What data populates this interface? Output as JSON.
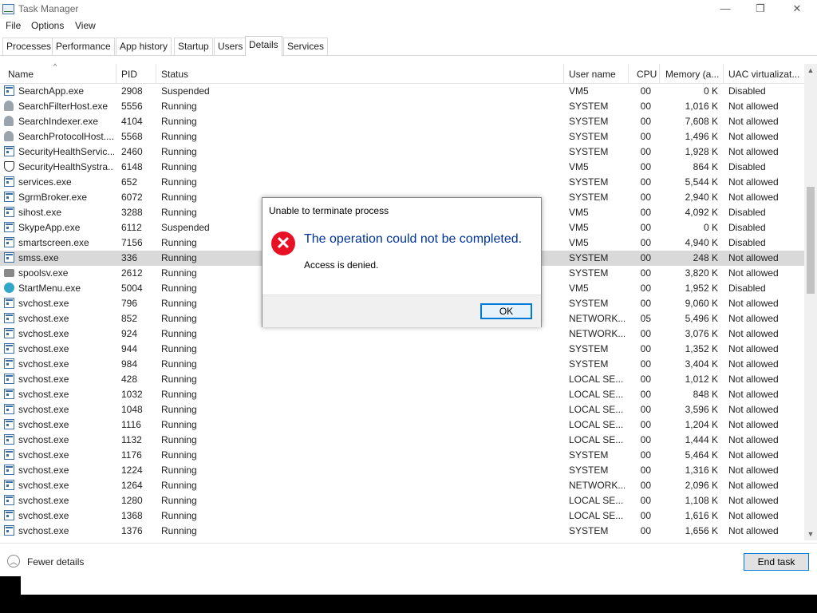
{
  "window": {
    "title": "Task Manager",
    "controls": {
      "minimize": "—",
      "restore": "❐",
      "close": "✕"
    }
  },
  "menu": [
    "File",
    "Options",
    "View"
  ],
  "tabs": [
    {
      "label": "Processes",
      "active": false
    },
    {
      "label": "Performance",
      "active": false
    },
    {
      "label": "App history",
      "active": false
    },
    {
      "label": "Startup",
      "active": false
    },
    {
      "label": "Users",
      "active": false
    },
    {
      "label": "Details",
      "active": true
    },
    {
      "label": "Services",
      "active": false
    }
  ],
  "columns": [
    "Name",
    "PID",
    "Status",
    "User name",
    "CPU",
    "Memory (a...",
    "UAC virtualizat..."
  ],
  "sort_indicator": "^",
  "rows": [
    {
      "icon": "window",
      "name": "SearchApp.exe",
      "pid": "2908",
      "status": "Suspended",
      "user": "VM5",
      "cpu": "00",
      "memory": "0 K",
      "uac": "Disabled"
    },
    {
      "icon": "person",
      "name": "SearchFilterHost.exe",
      "pid": "5556",
      "status": "Running",
      "user": "SYSTEM",
      "cpu": "00",
      "memory": "1,016 K",
      "uac": "Not allowed"
    },
    {
      "icon": "person",
      "name": "SearchIndexer.exe",
      "pid": "4104",
      "status": "Running",
      "user": "SYSTEM",
      "cpu": "00",
      "memory": "7,608 K",
      "uac": "Not allowed"
    },
    {
      "icon": "person",
      "name": "SearchProtocolHost....",
      "pid": "5568",
      "status": "Running",
      "user": "SYSTEM",
      "cpu": "00",
      "memory": "1,496 K",
      "uac": "Not allowed"
    },
    {
      "icon": "window",
      "name": "SecurityHealthServic...",
      "pid": "2460",
      "status": "Running",
      "user": "SYSTEM",
      "cpu": "00",
      "memory": "1,928 K",
      "uac": "Not allowed"
    },
    {
      "icon": "shield",
      "name": "SecurityHealthSystra...",
      "pid": "6148",
      "status": "Running",
      "user": "VM5",
      "cpu": "00",
      "memory": "864 K",
      "uac": "Disabled"
    },
    {
      "icon": "window",
      "name": "services.exe",
      "pid": "652",
      "status": "Running",
      "user": "SYSTEM",
      "cpu": "00",
      "memory": "5,544 K",
      "uac": "Not allowed"
    },
    {
      "icon": "window",
      "name": "SgrmBroker.exe",
      "pid": "6072",
      "status": "Running",
      "user": "SYSTEM",
      "cpu": "00",
      "memory": "2,940 K",
      "uac": "Not allowed"
    },
    {
      "icon": "window",
      "name": "sihost.exe",
      "pid": "3288",
      "status": "Running",
      "user": "VM5",
      "cpu": "00",
      "memory": "4,092 K",
      "uac": "Disabled"
    },
    {
      "icon": "window",
      "name": "SkypeApp.exe",
      "pid": "6112",
      "status": "Suspended",
      "user": "VM5",
      "cpu": "00",
      "memory": "0 K",
      "uac": "Disabled"
    },
    {
      "icon": "window",
      "name": "smartscreen.exe",
      "pid": "7156",
      "status": "Running",
      "user": "VM5",
      "cpu": "00",
      "memory": "4,940 K",
      "uac": "Disabled"
    },
    {
      "icon": "window",
      "name": "smss.exe",
      "pid": "336",
      "status": "Running",
      "user": "SYSTEM",
      "cpu": "00",
      "memory": "248 K",
      "uac": "Not allowed",
      "selected": true
    },
    {
      "icon": "printer",
      "name": "spoolsv.exe",
      "pid": "2612",
      "status": "Running",
      "user": "SYSTEM",
      "cpu": "00",
      "memory": "3,820 K",
      "uac": "Not allowed"
    },
    {
      "icon": "globe",
      "name": "StartMenu.exe",
      "pid": "5004",
      "status": "Running",
      "user": "VM5",
      "cpu": "00",
      "memory": "1,952 K",
      "uac": "Disabled"
    },
    {
      "icon": "window",
      "name": "svchost.exe",
      "pid": "796",
      "status": "Running",
      "user": "SYSTEM",
      "cpu": "00",
      "memory": "9,060 K",
      "uac": "Not allowed"
    },
    {
      "icon": "window",
      "name": "svchost.exe",
      "pid": "852",
      "status": "Running",
      "user": "NETWORK...",
      "cpu": "05",
      "memory": "5,496 K",
      "uac": "Not allowed"
    },
    {
      "icon": "window",
      "name": "svchost.exe",
      "pid": "924",
      "status": "Running",
      "user": "NETWORK...",
      "cpu": "00",
      "memory": "3,076 K",
      "uac": "Not allowed"
    },
    {
      "icon": "window",
      "name": "svchost.exe",
      "pid": "944",
      "status": "Running",
      "user": "SYSTEM",
      "cpu": "00",
      "memory": "1,352 K",
      "uac": "Not allowed"
    },
    {
      "icon": "window",
      "name": "svchost.exe",
      "pid": "984",
      "status": "Running",
      "user": "SYSTEM",
      "cpu": "00",
      "memory": "3,404 K",
      "uac": "Not allowed"
    },
    {
      "icon": "window",
      "name": "svchost.exe",
      "pid": "428",
      "status": "Running",
      "user": "LOCAL SE...",
      "cpu": "00",
      "memory": "1,012 K",
      "uac": "Not allowed"
    },
    {
      "icon": "window",
      "name": "svchost.exe",
      "pid": "1032",
      "status": "Running",
      "user": "LOCAL SE...",
      "cpu": "00",
      "memory": "848 K",
      "uac": "Not allowed"
    },
    {
      "icon": "window",
      "name": "svchost.exe",
      "pid": "1048",
      "status": "Running",
      "user": "LOCAL SE...",
      "cpu": "00",
      "memory": "3,596 K",
      "uac": "Not allowed"
    },
    {
      "icon": "window",
      "name": "svchost.exe",
      "pid": "1116",
      "status": "Running",
      "user": "LOCAL SE...",
      "cpu": "00",
      "memory": "1,204 K",
      "uac": "Not allowed"
    },
    {
      "icon": "window",
      "name": "svchost.exe",
      "pid": "1132",
      "status": "Running",
      "user": "LOCAL SE...",
      "cpu": "00",
      "memory": "1,444 K",
      "uac": "Not allowed"
    },
    {
      "icon": "window",
      "name": "svchost.exe",
      "pid": "1176",
      "status": "Running",
      "user": "SYSTEM",
      "cpu": "00",
      "memory": "5,464 K",
      "uac": "Not allowed"
    },
    {
      "icon": "window",
      "name": "svchost.exe",
      "pid": "1224",
      "status": "Running",
      "user": "SYSTEM",
      "cpu": "00",
      "memory": "1,316 K",
      "uac": "Not allowed"
    },
    {
      "icon": "window",
      "name": "svchost.exe",
      "pid": "1264",
      "status": "Running",
      "user": "NETWORK...",
      "cpu": "00",
      "memory": "2,096 K",
      "uac": "Not allowed"
    },
    {
      "icon": "window",
      "name": "svchost.exe",
      "pid": "1280",
      "status": "Running",
      "user": "LOCAL SE...",
      "cpu": "00",
      "memory": "1,108 K",
      "uac": "Not allowed"
    },
    {
      "icon": "window",
      "name": "svchost.exe",
      "pid": "1368",
      "status": "Running",
      "user": "LOCAL SE...",
      "cpu": "00",
      "memory": "1,616 K",
      "uac": "Not allowed"
    },
    {
      "icon": "window",
      "name": "svchost.exe",
      "pid": "1376",
      "status": "Running",
      "user": "SYSTEM",
      "cpu": "00",
      "memory": "1,656 K",
      "uac": "Not allowed"
    }
  ],
  "scrollbar": {
    "up": "▲",
    "down": "▼"
  },
  "footer": {
    "fewer_details": "Fewer details",
    "fewer_icon": "︿",
    "end_task": "End task"
  },
  "dialog": {
    "title": "Unable to terminate process",
    "error_icon": "✕",
    "main_instruction": "The operation could not be completed.",
    "content": "Access is denied.",
    "ok": "OK"
  },
  "colors": {
    "accent": "#0078d7",
    "error": "#e81123",
    "instruction": "#003399",
    "selected_row": "#d9d9d9"
  }
}
